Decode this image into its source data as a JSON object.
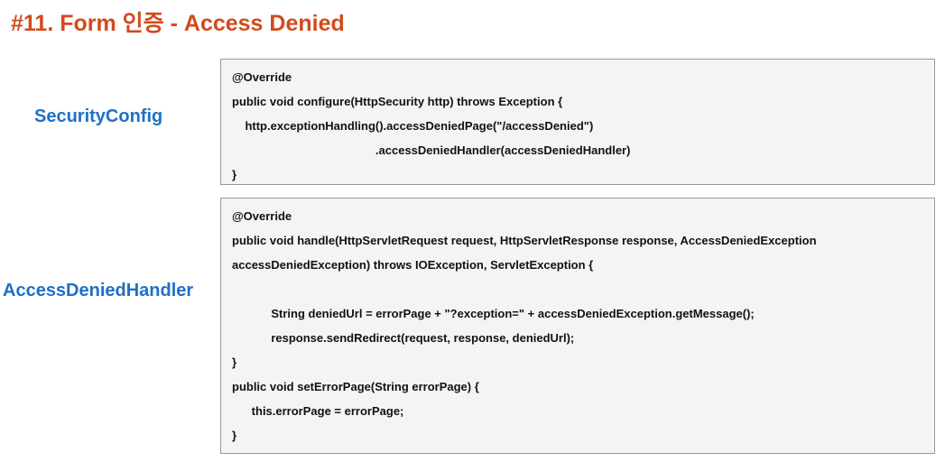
{
  "title": "#11. Form 인증 - Access Denied",
  "sections": {
    "security_config": {
      "label": "SecurityConfig",
      "code": [
        "@Override",
        "public void configure(HttpSecurity http) throws Exception {",
        "    http.exceptionHandling().accessDeniedPage(\"/accessDenied\")",
        "                                            .accessDeniedHandler(accessDeniedHandler)",
        "}"
      ]
    },
    "access_denied_handler": {
      "label": "AccessDeniedHandler",
      "code": [
        "@Override",
        "public void handle(HttpServletRequest request, HttpServletResponse response, AccessDeniedException",
        "accessDeniedException) throws IOException, ServletException {",
        "",
        "            String deniedUrl = errorPage + \"?exception=\" + accessDeniedException.getMessage();",
        "            response.sendRedirect(request, response, deniedUrl);",
        "}",
        "public void setErrorPage(String errorPage) {",
        "      this.errorPage = errorPage;",
        "}"
      ]
    }
  },
  "colors": {
    "title": "#d24a1e",
    "label": "#1f6fc7",
    "code_bg": "#f4f4f4",
    "code_border": "#9a9a9a"
  }
}
